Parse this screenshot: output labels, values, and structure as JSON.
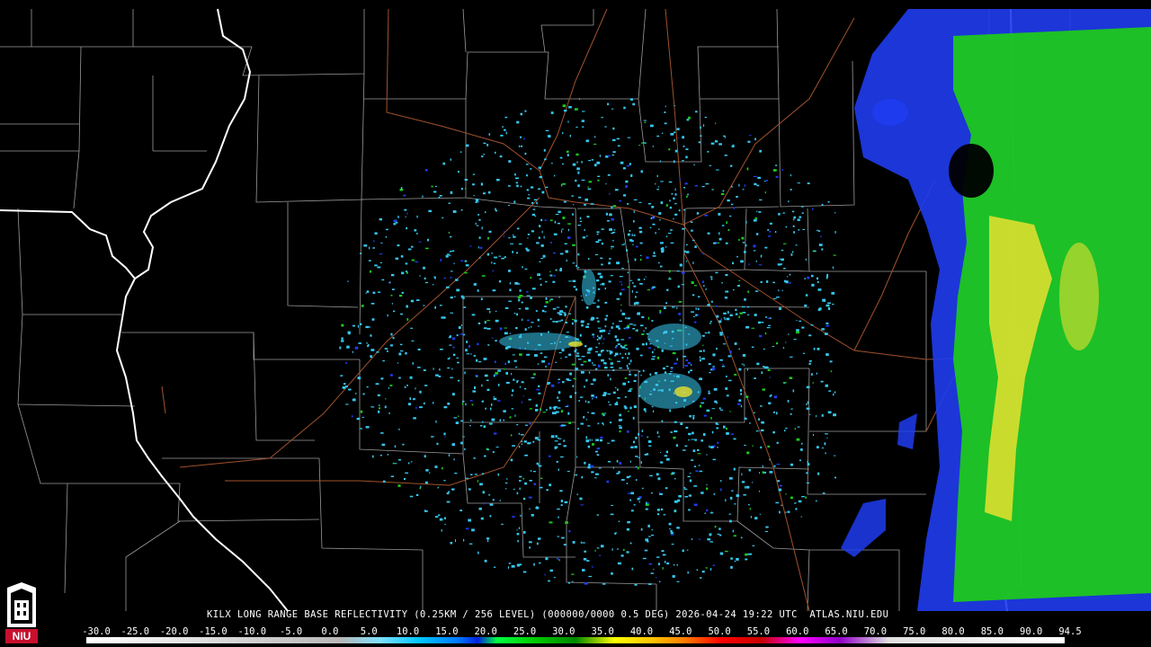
{
  "product": {
    "caption": "KILX LONG RANGE BASE REFLECTIVITY (0.25KM / 256 LEVEL) (000000/0000 0.5 DEG) 2026-04-24 19:22 UTC  ATLAS.NIU.EDU"
  },
  "logo": {
    "text": "NIU"
  },
  "legend": {
    "labels": [
      "-30.0",
      "-25.0",
      "-20.0",
      "-15.0",
      "-10.0",
      "-5.0",
      "0.0",
      "5.0",
      "10.0",
      "15.0",
      "20.0",
      "25.0",
      "30.0",
      "35.0",
      "40.0",
      "45.0",
      "50.0",
      "55.0",
      "60.0",
      "65.0",
      "70.0",
      "75.0",
      "80.0",
      "85.0",
      "90.0",
      "94.5"
    ]
  },
  "colors": {
    "background": "#000000",
    "state_border": "#ffffff",
    "county_border": "#9a9a9a",
    "highway": "#a0522d",
    "echo_light": "#36c8f0",
    "echo_blue": "#1f3cf0",
    "echo_green": "#1ec81e",
    "echo_yellow": "#e8e030"
  }
}
